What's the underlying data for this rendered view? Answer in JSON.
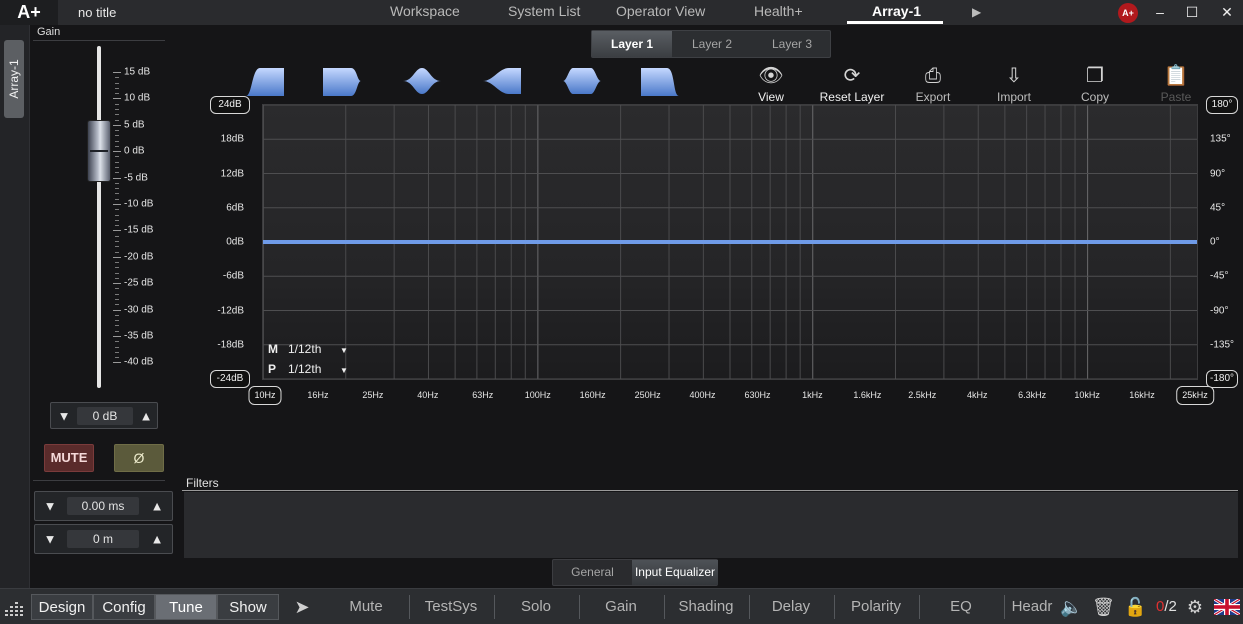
{
  "titlebar": {
    "logo": "A+",
    "doc_title": "no title",
    "tabs": [
      "Workspace",
      "System List",
      "Operator View",
      "Health+",
      "Array-1"
    ],
    "active_tab": "Array-1",
    "badge": "A+",
    "minimize": "–",
    "maximize": "☐",
    "close": "✕"
  },
  "side_tab": {
    "label": "Array-1"
  },
  "gain": {
    "title": "Gain",
    "scale": [
      "15 dB",
      "10 dB",
      "5 dB",
      "0 dB",
      "-5 dB",
      "-10 dB",
      "-15 dB",
      "-20 dB",
      "-25 dB",
      "-30 dB",
      "-35 dB",
      "-40 dB"
    ],
    "value": "0 dB",
    "fader_level_db": 0,
    "mute_label": "MUTE",
    "phase_label": "Ø",
    "delay_ms": "0.00 ms",
    "delay_m": "0 m"
  },
  "layers": {
    "tabs": [
      "Layer 1",
      "Layer 2",
      "Layer 3"
    ],
    "active": "Layer 1"
  },
  "filter_types": [
    "low-shelf-icon",
    "high-cut-icon",
    "bell-icon",
    "notch-bell-icon",
    "band-pass-icon",
    "high-shelf-icon"
  ],
  "toolbar": {
    "view": "View",
    "reset_layer": "Reset Layer",
    "export": "Export",
    "import": "Import",
    "copy": "Copy",
    "paste": "Paste"
  },
  "graph": {
    "db_labels": [
      "24dB",
      "18dB",
      "12dB",
      "6dB",
      "0dB",
      "-6dB",
      "-12dB",
      "-18dB",
      "-24dB"
    ],
    "phase_labels": [
      "180°",
      "135°",
      "90°",
      "45°",
      "0°",
      "-45°",
      "-90°",
      "-135°",
      "-180°"
    ],
    "freq_labels": [
      "10Hz",
      "16Hz",
      "25Hz",
      "40Hz",
      "63Hz",
      "100Hz",
      "160Hz",
      "250Hz",
      "400Hz",
      "630Hz",
      "1kHz",
      "1.6kHz",
      "2.5kHz",
      "4kHz",
      "6.3kHz",
      "10kHz",
      "16kHz",
      "25kHz"
    ],
    "magnitude_smoothing_key": "M",
    "magnitude_smoothing": "1/12th",
    "phase_smoothing_key": "P",
    "phase_smoothing": "1/12th",
    "curve_color": "#6f9be8"
  },
  "chart_data": {
    "type": "line",
    "xlim": [
      10,
      25000
    ],
    "x_scale": "log",
    "ylim": [
      -24,
      24
    ],
    "y2lim": [
      -180,
      180
    ],
    "series": [
      {
        "x": [
          10,
          25000
        ],
        "y": [
          0,
          0
        ]
      }
    ],
    "grid": true
  },
  "filters": {
    "title": "Filters"
  },
  "sub_tabs": {
    "tabs": [
      "General",
      "Input Equalizer"
    ],
    "active": "Input Equalizer"
  },
  "bottombar": {
    "modes": [
      "Design",
      "Config",
      "Tune",
      "Show"
    ],
    "active_mode": "Tune",
    "actions": [
      "Mute",
      "TestSys",
      "Solo",
      "Gain",
      "Shading",
      "Delay",
      "Polarity",
      "EQ",
      "Headr"
    ],
    "count_current": "0",
    "count_total": "/2"
  }
}
